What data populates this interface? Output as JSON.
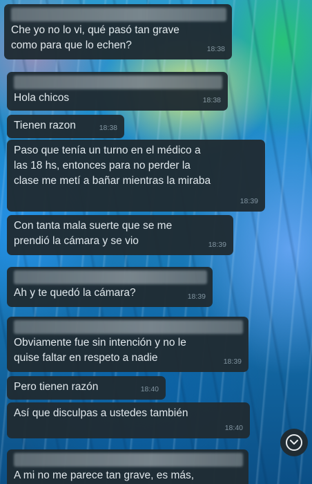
{
  "messages": [
    {
      "text": "Che yo no lo vi, qué pasó tan grave\ncomo para que lo echen?",
      "time": "18:38"
    },
    {
      "text": "Hola chicos",
      "time": "18:38"
    },
    {
      "text": "Tienen razon",
      "time": "18:38"
    },
    {
      "text": "Paso que tenía un turno en el médico a\nlas 18 hs, entonces para no perder la\nclase me metí a bañar mientras la miraba",
      "time": "18:39"
    },
    {
      "text": "Con tanta mala suerte que se me\nprendió la cámara y se vio",
      "time": "18:39"
    },
    {
      "text": "Ah y te quedó la cámara?",
      "time": "18:39"
    },
    {
      "text": "Obviamente fue sin intención y no le\nquise faltar en respeto a nadie",
      "time": "18:39"
    },
    {
      "text": "Pero tienen razón",
      "time": "18:40"
    },
    {
      "text": "Así que disculpas a ustedes también",
      "time": "18:40"
    },
    {
      "text": "A mi no me parece tan grave, es más,",
      "time": ""
    }
  ],
  "icons": {
    "scroll_down": "chevron-down-circle-icon"
  }
}
